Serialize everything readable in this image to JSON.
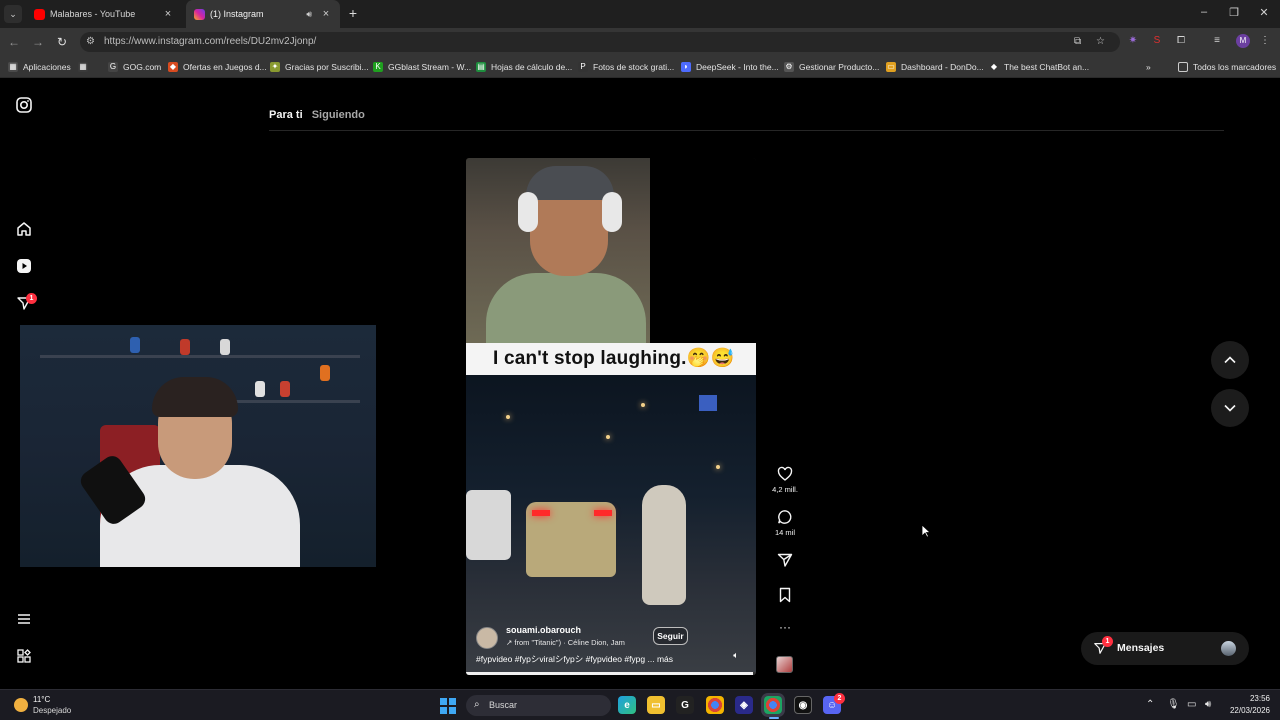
{
  "browser": {
    "tabs": [
      {
        "title": "Malabares - YouTube",
        "favicon_color": "#ff0000"
      },
      {
        "title": "(1) Instagram",
        "favicon_color": "#d6249f"
      }
    ],
    "url": "https://www.instagram.com/reels/DU2mv2Jjonp/",
    "profile_initial": "M",
    "bookmarks": [
      {
        "label": "Aplicaciones",
        "icon": "apps-grid-icon"
      },
      {
        "label": "GOG.com",
        "icon": "gog-icon"
      },
      {
        "label": "Ofertas en Juegos d...",
        "icon": "tag-icon"
      },
      {
        "label": "Gracias por Suscribi...",
        "icon": "bird-icon"
      },
      {
        "label": "GGblast Stream - W...",
        "icon": "k-icon"
      },
      {
        "label": "Hojas de cálculo de...",
        "icon": "sheets-icon"
      },
      {
        "label": "Fotos de stock grati...",
        "icon": "p-icon"
      },
      {
        "label": "DeepSeek - Into the...",
        "icon": "deepseek-icon"
      },
      {
        "label": "Gestionar Producto...",
        "icon": "gear-icon"
      },
      {
        "label": "Dashboard - DonDo...",
        "icon": "folder-icon"
      },
      {
        "label": "The best ChatBot an...",
        "icon": "diamond-icon"
      }
    ],
    "all_bookmarks": "Todos los marcadores"
  },
  "instagram": {
    "feed_tabs": {
      "for_you": "Para ti",
      "following": "Siguiendo"
    },
    "notification_badge": "1",
    "reel": {
      "caption_overlay": "I can't stop laughing.🤭😅",
      "author": "souami.obarouch",
      "audio": "from \"Titanic\") · Céline Dion, Jam",
      "follow_label": "Seguir",
      "description": "#fypvideo #fypシviralシfypシ #fypvideo #fypg ... más",
      "progress_fraction": 0.99
    },
    "actions": {
      "likes": "4,2 mill.",
      "comments": "14 mil"
    },
    "messages": {
      "label": "Mensajes",
      "badge": "1"
    }
  },
  "taskbar": {
    "weather_temp": "11°C",
    "weather_desc": "Despejado",
    "search_placeholder": "Buscar",
    "discord_badge": "2",
    "time": "23:56",
    "date": "22/03/2026"
  }
}
